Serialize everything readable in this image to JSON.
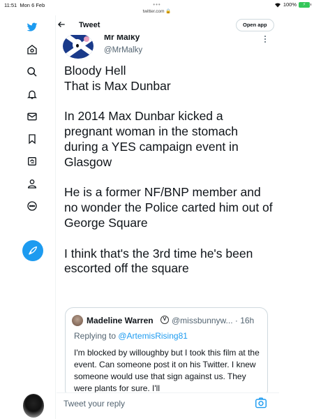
{
  "status": {
    "time": "11:51",
    "date": "Mon 6 Feb",
    "battery": "100%"
  },
  "browser": {
    "url": "twitter.com"
  },
  "header": {
    "title": "Tweet",
    "open_app_label": "Open app"
  },
  "sidebar": {
    "items": [
      {
        "icon": "twitter-bird-icon"
      },
      {
        "icon": "home-icon"
      },
      {
        "icon": "search-icon"
      },
      {
        "icon": "notifications-bell-icon"
      },
      {
        "icon": "messages-envelope-icon"
      },
      {
        "icon": "bookmark-icon"
      },
      {
        "icon": "lists-icon"
      },
      {
        "icon": "profile-icon"
      },
      {
        "icon": "more-circle-icon"
      }
    ],
    "compose_icon": "compose-feather-icon"
  },
  "tweet": {
    "author_name": "Mr Malky",
    "author_handle": "@MrMalky",
    "text": "Bloody Hell\nThat is Max Dunbar\n\nIn 2014 Max Dunbar kicked a pregnant woman in the stomach during a YES campaign event in Glasgow\n\nHe is a former NF/BNP member and no wonder the Police carted him out of George Square\n\nI think that's the 3rd time he's been escorted off the square"
  },
  "quoted": {
    "name": "Madeline Warren",
    "verified_glyph": "V",
    "handle_time": "@missbunnyw... · 16h",
    "replying_prefix": "Replying to ",
    "replying_to": "@ArtemisRising81",
    "text": "I'm blocked by willoughby but I took this film at the event. Can someone post it on his Twitter. I knew someone would use that sign against us. They were plants for sure. I'll"
  },
  "reply": {
    "placeholder": "Tweet your reply"
  },
  "colors": {
    "accent": "#1d9bf0",
    "text_primary": "#0f1419",
    "text_secondary": "#536471",
    "border": "#cfd9de",
    "battery": "#34c759"
  }
}
